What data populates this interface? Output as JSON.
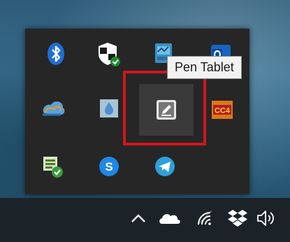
{
  "tooltip": {
    "text": "Pen Tablet"
  },
  "tray_flyout": {
    "icons": [
      {
        "name": "bluetooth-icon"
      },
      {
        "name": "windows-security-icon"
      },
      {
        "name": "network-monitor-icon"
      },
      {
        "name": "outlook-icon"
      },
      {
        "name": "cloud-app-icon"
      },
      {
        "name": "generic-app-icon"
      },
      {
        "name": "pen-tablet-icon"
      },
      {
        "name": "cc-app-icon",
        "label": "CC4"
      },
      {
        "name": "sync-check-icon"
      },
      {
        "name": "skype-icon",
        "label": "S"
      },
      {
        "name": "telegram-icon"
      }
    ]
  },
  "taskbar": {
    "icons": [
      {
        "name": "show-hidden-icons-chevron-icon"
      },
      {
        "name": "onedrive-icon"
      },
      {
        "name": "wifi-icon"
      },
      {
        "name": "dropbox-icon"
      },
      {
        "name": "volume-icon"
      }
    ]
  },
  "colors": {
    "highlight_box": "#d0161d",
    "flyout_bg": "#262626",
    "taskbar_bg": "#1c2328"
  }
}
